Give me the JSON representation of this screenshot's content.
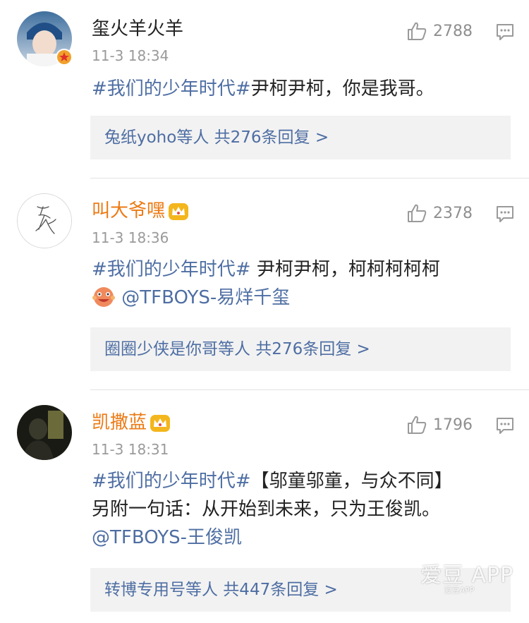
{
  "comments": [
    {
      "username": "玺火羊火羊",
      "time": "11-3 18:34",
      "likes": "2788",
      "topic": "#我们的少年时代#",
      "text1": "尹柯尹柯，你是我哥。",
      "replies": "兔纸yoho等人  共276条回复 >"
    },
    {
      "username": "叫大爷嘿",
      "time": "11-3 18:36",
      "likes": "2378",
      "topic": "#我们的少年时代#",
      "text1": " 尹柯尹柯，柯柯柯柯柯",
      "mention": "@TFBOYS-易烊千玺",
      "replies": "圈圈少侠是你哥等人  共276条回复 >"
    },
    {
      "username": "凯撒蓝",
      "time": "11-3 18:31",
      "likes": "1796",
      "topic": "#我们的少年时代#",
      "text1": "【邬童邬童，与众不同】",
      "text2": "另附一句话：从开始到未来，只为王俊凯。",
      "mention": "@TFBOYS-王俊凯",
      "replies": "转博专用号等人  共447条回复 >"
    }
  ],
  "watermark": {
    "main": "爱豆 APP",
    "sub": "爱豆APP"
  },
  "colors": {
    "link": "#4e6ea3",
    "vip_name": "#ec7a14",
    "meta": "#9a9a9a",
    "reply_bg": "#f2f2f2"
  },
  "icons": [
    "verified-badge-icon",
    "like-thumb-icon",
    "reply-comment-icon",
    "vip-crown-icon",
    "emoji-face-icon"
  ]
}
